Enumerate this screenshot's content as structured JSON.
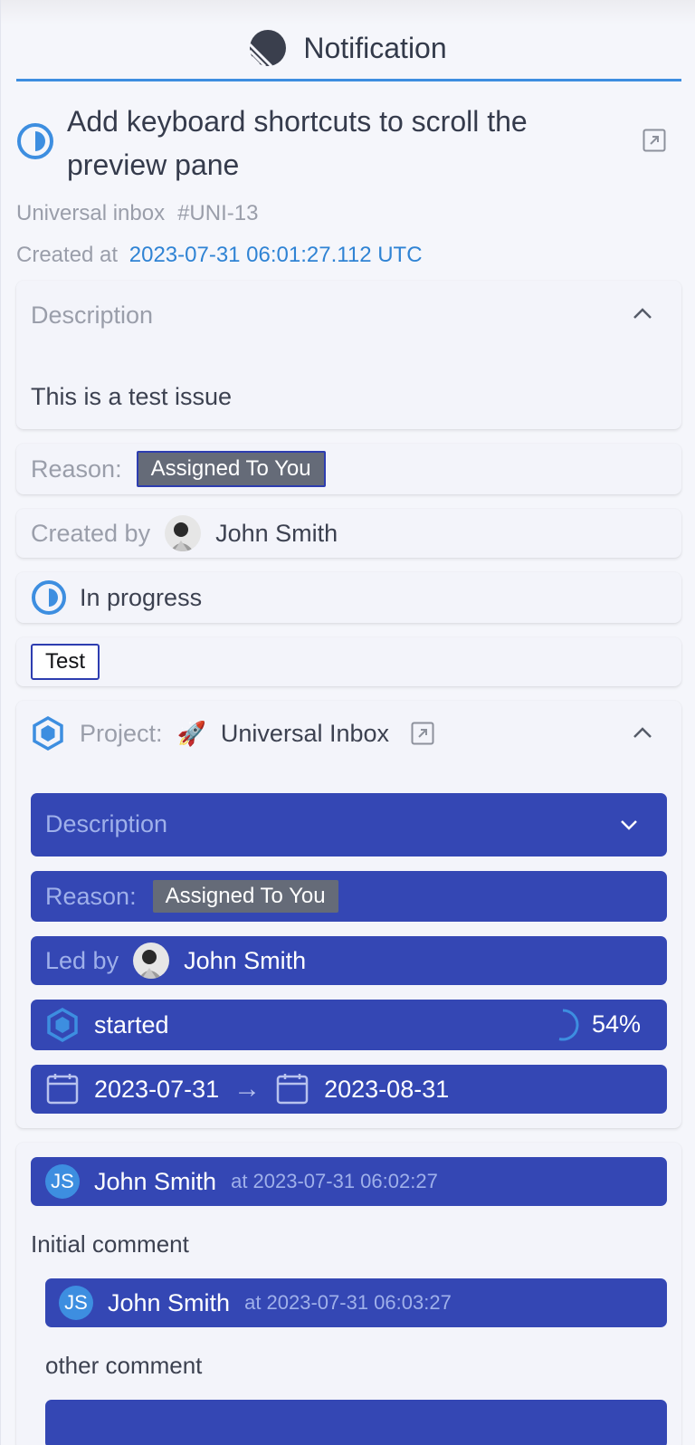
{
  "header": {
    "title": "Notification",
    "icon": "linear-logo-icon"
  },
  "issue": {
    "title": "Add keyboard shortcuts to scroll the preview pane",
    "team": "Universal inbox",
    "identifier": "#UNI-13",
    "created_label": "Created at",
    "created_at": "2023-07-31 06:01:27.112 UTC"
  },
  "description": {
    "label": "Description",
    "text": "This is a test issue"
  },
  "reason": {
    "label": "Reason:",
    "value": "Assigned To You"
  },
  "creator": {
    "label": "Created by",
    "name": "John Smith"
  },
  "status": {
    "label": "In progress"
  },
  "labels": [
    "Test"
  ],
  "project": {
    "label": "Project:",
    "emoji": "🚀",
    "name": "Universal Inbox",
    "description_label": "Description",
    "reason_label": "Reason:",
    "reason_value": "Assigned To You",
    "lead_label": "Led by",
    "lead_name": "John Smith",
    "state": "started",
    "progress": "54%",
    "progress_value": 0.54,
    "start_date": "2023-07-31",
    "arrow": "→",
    "target_date": "2023-08-31"
  },
  "comments": [
    {
      "initials": "JS",
      "author": "John Smith",
      "time": "at 2023-07-31 06:02:27",
      "text": "Initial comment"
    },
    {
      "initials": "JS",
      "author": "John Smith",
      "time": "at 2023-07-31 06:03:27",
      "text": "other comment"
    }
  ],
  "colors": {
    "accent": "#3d8ee0",
    "bar_blue": "#3447b4",
    "badge_gray": "#656b78",
    "created_date": "#2f83d4"
  }
}
